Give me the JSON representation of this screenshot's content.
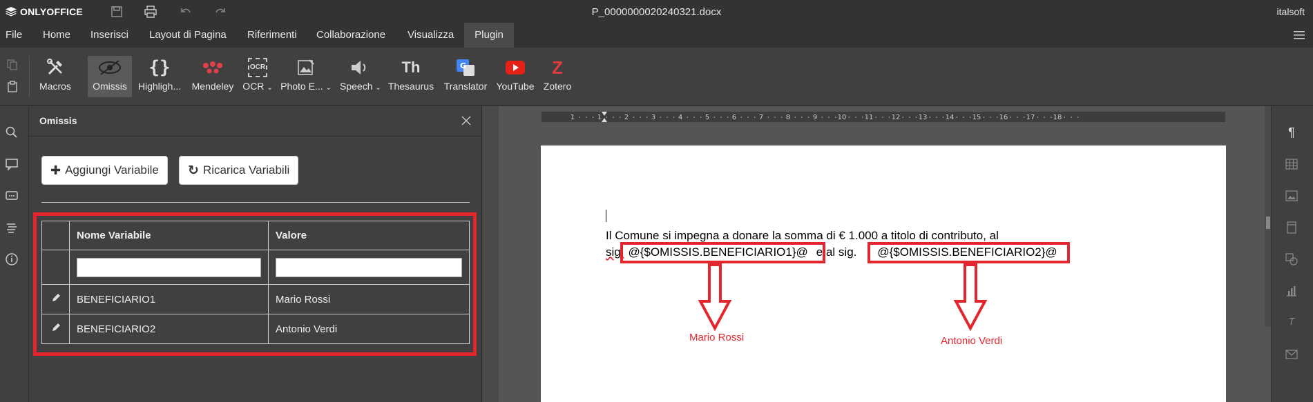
{
  "app": {
    "name": "ONLYOFFICE",
    "document_title": "P_0000000020240321.docx",
    "user": "italsoft"
  },
  "menu": [
    "File",
    "Home",
    "Inserisci",
    "Layout di Pagina",
    "Riferimenti",
    "Collaborazione",
    "Visualizza",
    "Plugin"
  ],
  "active_menu": "Plugin",
  "toolbar": {
    "macros": "Macros",
    "omissis": "Omissis",
    "highlight": "Highligh...",
    "mendeley": "Mendeley",
    "ocr": "OCR",
    "ocr_icon_text": "OCR",
    "photo": "Photo E...",
    "speech": "Speech",
    "thesaurus": "Thesaurus",
    "thesaurus_icon_text": "Th",
    "translator": "Translator",
    "youtube": "YouTube",
    "zotero": "Zotero",
    "zotero_icon_text": "Z"
  },
  "panel": {
    "title": "Omissis",
    "add_button": "Aggiungi Variabile",
    "reload_button": "Ricarica Variabili",
    "columns": [
      "Nome Variabile",
      "Valore"
    ],
    "rows": [
      {
        "name": "BENEFICIARIO1",
        "value": "Mario Rossi"
      },
      {
        "name": "BENEFICIARIO2",
        "value": "Antonio Verdi"
      }
    ]
  },
  "ruler": [
    "1",
    "1",
    "2",
    "3",
    "4",
    "5",
    "6",
    "7",
    "8",
    "9",
    "10",
    "11",
    "12",
    "13",
    "14",
    "15",
    "16",
    "17",
    "18"
  ],
  "document": {
    "line1": "Il Comune si impegna a donare la somma di € 1.000 a titolo di contributo, al",
    "line2_prefix": "sig.",
    "var1": "@{$OMISSIS.BENEFICIARIO1}@",
    "line2_middle": "e al sig.",
    "var2": "@{$OMISSIS.BENEFICIARIO2}@"
  },
  "annotations": {
    "arrow1_label": "Mario Rossi",
    "arrow2_label": "Antonio Verdi"
  },
  "colors": {
    "highlight_red": "#e3262e",
    "active_tool": "#5a5a5a"
  }
}
